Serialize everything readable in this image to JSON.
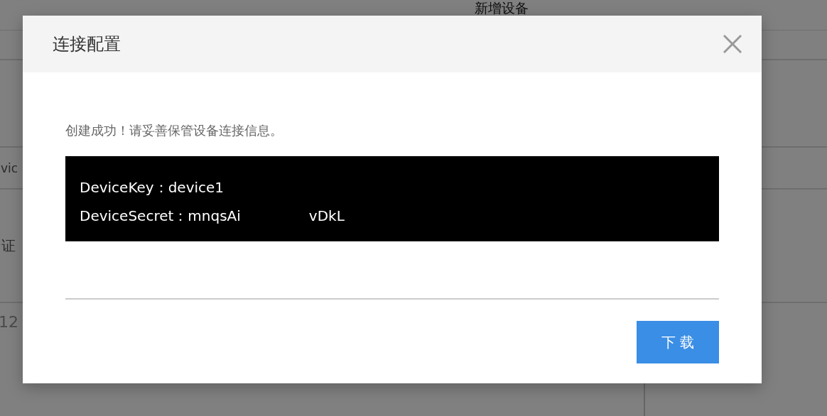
{
  "background_page": {
    "title": "新增设备",
    "field_value": "vic",
    "field_label": "证",
    "textarea_value": "12"
  },
  "dialog": {
    "title": "连接配置",
    "message": "创建成功！请妥善保管设备连接信息。",
    "credentials": [
      {
        "label": "DeviceKey：",
        "value_parts": [
          "device1"
        ]
      },
      {
        "label": "DeviceSecret：",
        "value_parts": [
          "mnqsAi",
          "vDkL"
        ]
      }
    ],
    "buttons": [
      {
        "label": "下 载",
        "kind": "primary"
      }
    ]
  }
}
